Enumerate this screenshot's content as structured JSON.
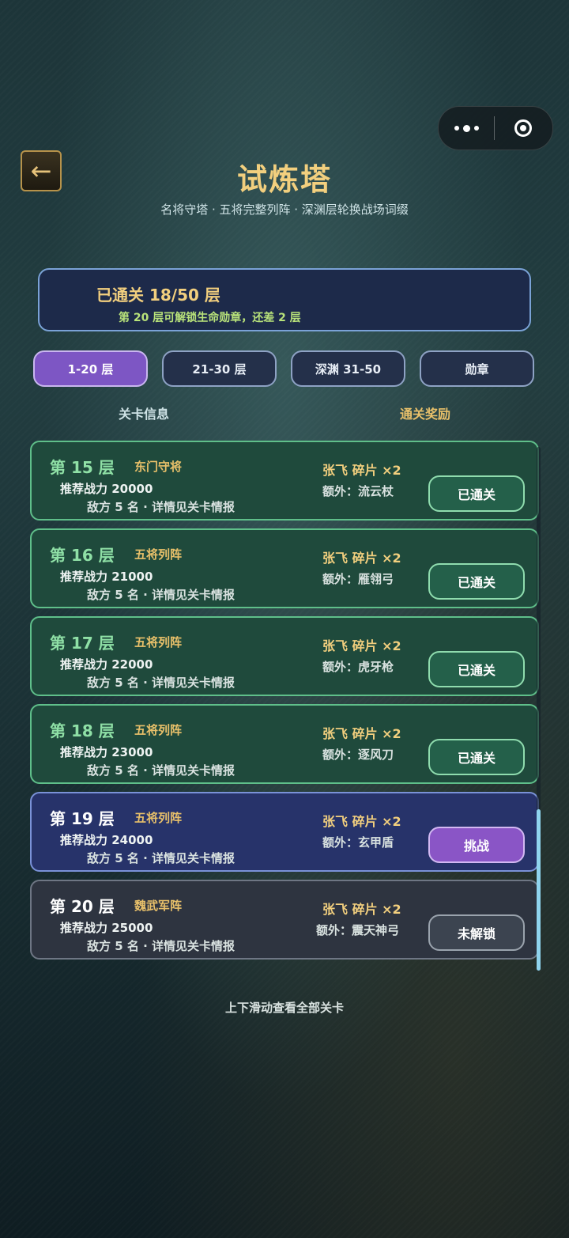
{
  "header": {
    "title": "试炼塔",
    "subtitle": "名将守塔 · 五将完整列阵 · 深渊层轮换战场词缀"
  },
  "progress": {
    "main": "已通关 18/50 层",
    "hint": "第 20 层可解锁生命勋章，还差 2 层"
  },
  "tabs": [
    {
      "label": "1-20 层",
      "active": true
    },
    {
      "label": "21-30 层",
      "active": false
    },
    {
      "label": "深渊 31-50",
      "active": false
    },
    {
      "label": "勋章",
      "active": false
    }
  ],
  "columns": {
    "info": "关卡信息",
    "reward": "通关奖励"
  },
  "levels": [
    {
      "name": "第 15 层",
      "tag": "东门守将",
      "power": "推荐战力 20000",
      "enemy": "敌方 5 名 · 详情见关卡情报",
      "reward": "张飞 碎片 ×2",
      "extra": "额外：流云杖",
      "button": "已通关",
      "state": "cleared"
    },
    {
      "name": "第 16 层",
      "tag": "五将列阵",
      "power": "推荐战力 21000",
      "enemy": "敌方 5 名 · 详情见关卡情报",
      "reward": "张飞 碎片 ×2",
      "extra": "额外：雁翎弓",
      "button": "已通关",
      "state": "cleared"
    },
    {
      "name": "第 17 层",
      "tag": "五将列阵",
      "power": "推荐战力 22000",
      "enemy": "敌方 5 名 · 详情见关卡情报",
      "reward": "张飞 碎片 ×2",
      "extra": "额外：虎牙枪",
      "button": "已通关",
      "state": "cleared"
    },
    {
      "name": "第 18 层",
      "tag": "五将列阵",
      "power": "推荐战力 23000",
      "enemy": "敌方 5 名 · 详情见关卡情报",
      "reward": "张飞 碎片 ×2",
      "extra": "额外：逐风刀",
      "button": "已通关",
      "state": "cleared"
    },
    {
      "name": "第 19 层",
      "tag": "五将列阵",
      "power": "推荐战力 24000",
      "enemy": "敌方 5 名 · 详情见关卡情报",
      "reward": "张飞 碎片 ×2",
      "extra": "额外：玄甲盾",
      "button": "挑战",
      "state": "current"
    },
    {
      "name": "第 20 层",
      "tag": "魏武军阵",
      "power": "推荐战力 25000",
      "enemy": "敌方 5 名 · 详情见关卡情报",
      "reward": "张飞 碎片 ×2",
      "extra": "额外：震天神弓",
      "button": "未解锁",
      "state": "locked"
    }
  ],
  "footer": {
    "hint": "上下滑动查看全部关卡"
  },
  "icons": {
    "back": "back-arrow-icon",
    "more": "more-dots-icon",
    "close": "target-close-icon"
  },
  "colors": {
    "title": "#f2cf7e",
    "cleared": "#1f4a3c",
    "current": "#27336a",
    "locked": "#2e3440",
    "active_tab": "#7d56c4"
  }
}
